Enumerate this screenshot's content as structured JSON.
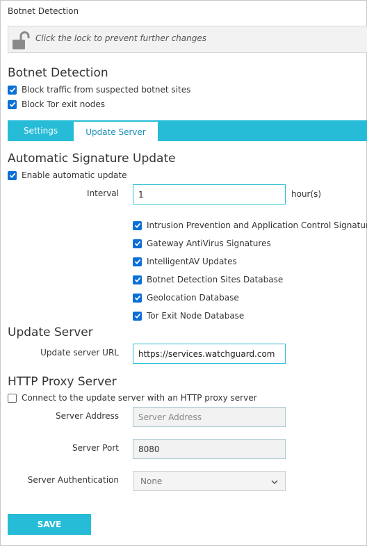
{
  "window": {
    "title": "Botnet Detection"
  },
  "lockbar": {
    "text": "Click the lock to prevent further changes",
    "icon": "unlocked-padlock-icon"
  },
  "botnet": {
    "heading": "Botnet Detection",
    "options": [
      {
        "label": "Block traffic from suspected botnet sites",
        "checked": true
      },
      {
        "label": "Block Tor exit nodes",
        "checked": true
      }
    ]
  },
  "tabs": [
    {
      "label": "Settings",
      "active": false
    },
    {
      "label": "Update Server",
      "active": true
    }
  ],
  "auto_update": {
    "heading": "Automatic Signature Update",
    "enable_label": "Enable automatic update",
    "enable_checked": true,
    "interval_label": "Interval",
    "interval_value": "1",
    "interval_unit": "hour(s)",
    "signatures": [
      {
        "label": "Intrusion Prevention and Application Control Signatures",
        "checked": true
      },
      {
        "label": "Gateway AntiVirus Signatures",
        "checked": true
      },
      {
        "label": "IntelligentAV Updates",
        "checked": true
      },
      {
        "label": "Botnet Detection Sites Database",
        "checked": true
      },
      {
        "label": "Geolocation Database",
        "checked": true
      },
      {
        "label": "Tor Exit Node Database",
        "checked": true
      }
    ]
  },
  "update_server": {
    "heading": "Update Server",
    "url_label": "Update server URL",
    "url_value": "https://services.watchguard.com"
  },
  "proxy": {
    "heading": "HTTP Proxy Server",
    "connect_label": "Connect to the update server with an HTTP proxy server",
    "connect_checked": false,
    "address_label": "Server Address",
    "address_placeholder": "Server Address",
    "port_label": "Server Port",
    "port_value": "8080",
    "auth_label": "Server Authentication",
    "auth_selected": "None"
  },
  "actions": {
    "save_label": "SAVE"
  },
  "colors": {
    "accent": "#26bcd7",
    "checkbox": "#0b6fd8",
    "tab_active_text": "#1d8fb8"
  }
}
